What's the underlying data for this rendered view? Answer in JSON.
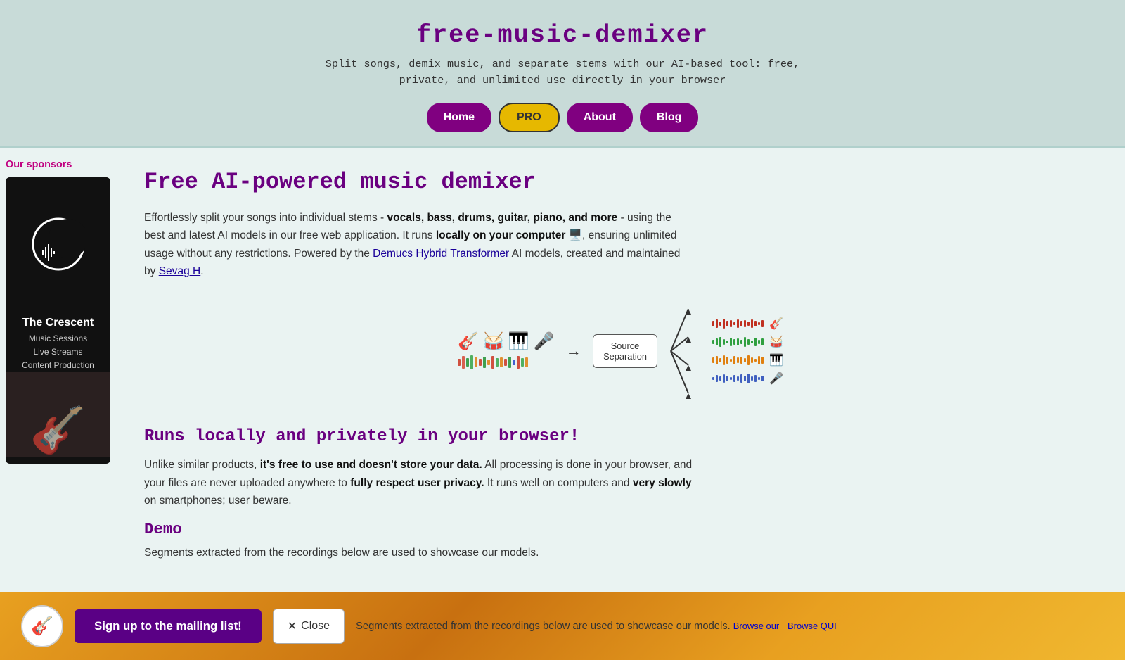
{
  "header": {
    "title": "free-music-demixer",
    "subtitle": "Split songs, demix music, and separate stems with our AI-based tool: free, private, and unlimited use directly in your browser",
    "nav": {
      "home": "Home",
      "pro": "PRO",
      "about": "About",
      "blog": "Blog"
    }
  },
  "sidebar": {
    "sponsors_label": "Our sponsors",
    "sponsor": {
      "name": "The Crescent",
      "details_line1": "Music Sessions",
      "details_line2": "Live Streams",
      "details_line3": "Content Production"
    }
  },
  "content": {
    "main_heading": "Free AI-powered music demixer",
    "intro": "Effortlessly split your songs into individual stems - ",
    "intro_bold": "vocals, bass, drums, guitar, piano, and more",
    "intro_cont": " - using the best and latest AI models in our free web application. It runs ",
    "locally_bold": "locally on your computer 🖥️",
    "intro_cont2": ", ensuring unlimited usage without any restrictions. Powered by the ",
    "demucs_link": "Demucs Hybrid Transformer",
    "intro_cont3": " AI models, created and maintained by ",
    "sevag_link": "Sevag H",
    "intro_end": ".",
    "diagram": {
      "source_sep_label": "Source\nSeparation",
      "arrow_label": "→"
    },
    "subheading": "Runs locally and privately in your browser!",
    "privacy_intro": "Unlike similar products, ",
    "privacy_bold": "it's free to use and doesn't store your data.",
    "privacy_cont": " All processing is done in your browser, and your files are never uploaded anywhere to ",
    "privacy_bold2": "fully respect user privacy.",
    "privacy_cont2": " It runs well on computers and ",
    "privacy_bold3": "very slowly",
    "privacy_end": " on smartphones; user beware.",
    "demo_heading": "Demo",
    "demo_text": "Segments extracted from the recordings below are used to showcase our models. "
  },
  "bottom_bar": {
    "cta_label": "Sign up to the mailing list!",
    "close_label": "Close",
    "close_x": "✕",
    "browse_qui": "Browse QUI",
    "text_before": "Segments extracted from the recordings below are used to showcase our models. ",
    "browse_link_text": "Browse our"
  },
  "waveform_bars": [
    4,
    8,
    14,
    10,
    16,
    12,
    8,
    14,
    18,
    12,
    8,
    6
  ]
}
